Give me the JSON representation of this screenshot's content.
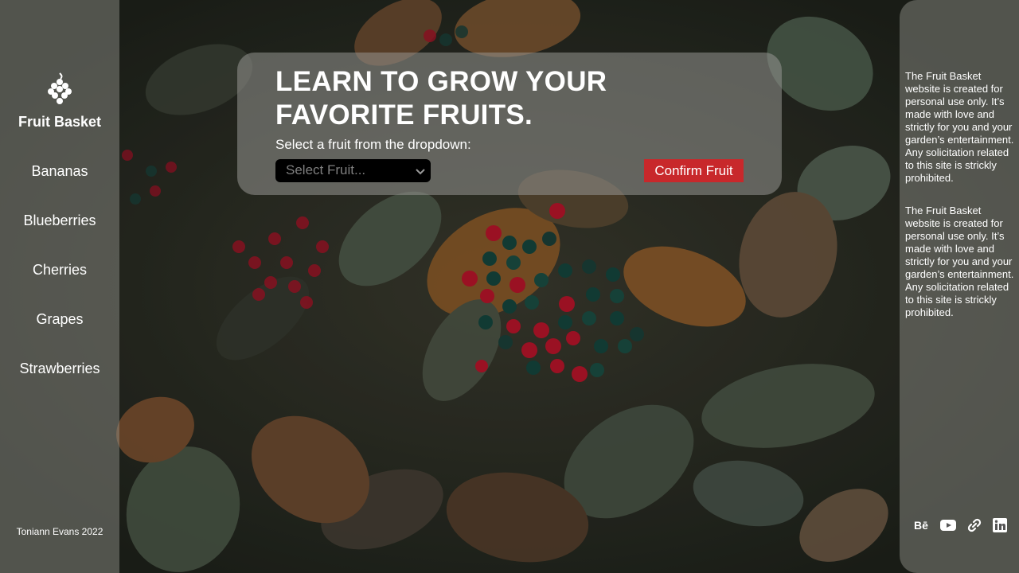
{
  "sidebar": {
    "brand": "Fruit Basket",
    "logo_icon": "grapes-icon",
    "items": [
      {
        "label": "Bananas"
      },
      {
        "label": "Blueberries"
      },
      {
        "label": "Cherries"
      },
      {
        "label": "Grapes"
      },
      {
        "label": "Strawberries"
      }
    ],
    "copyright": "Toniann Evans 2022"
  },
  "card": {
    "headline": "LEARN TO GROW YOUR FAVORITE FRUITS.",
    "prompt": "Select a fruit from the dropdown:",
    "select_placeholder": "Select Fruit...",
    "confirm_label": "Confirm Fruit",
    "accent_color": "#c8282b"
  },
  "notices": [
    "The Fruit Basket website is created for personal use only. It’s made with love and strictly for you and your garden’s entertainment. Any solicitation related to this site is strickly prohibited.",
    "The Fruit Basket website is created for personal use only. It’s made with love and strictly for you and your garden’s entertainment. Any solicitation related to this site is strickly prohibited."
  ],
  "social": {
    "behance_label": "Bē",
    "icons": [
      "behance-icon",
      "youtube-icon",
      "link-icon",
      "linkedin-icon"
    ]
  }
}
